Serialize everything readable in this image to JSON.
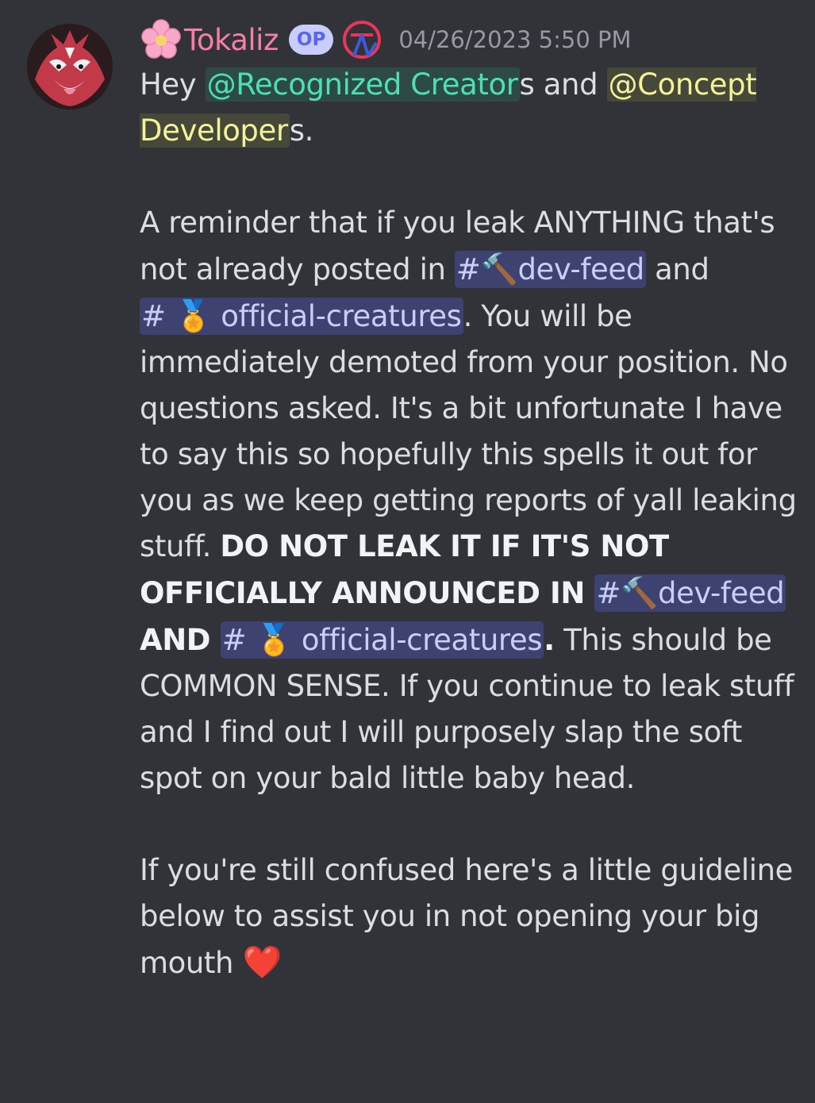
{
  "message": {
    "author": "Tokaliz",
    "author_color": "#f47fa6",
    "badge": "OP",
    "timestamp": "04/26/2023 5:50 PM",
    "icons": {
      "name_prefix": "cherry-blossom-icon",
      "role": "role-badge-icon"
    },
    "body": {
      "greeting_hey": "Hey ",
      "mention_creators": "@Recognized Creator",
      "s_and": "s and ",
      "mention_developers": "@Concept Developer",
      "s_period": "s.",
      "p2_part1": "A reminder that if you leak ANYTHING that's not already posted in ",
      "channel_devfeed": "dev-feed",
      "and": " and ",
      "channel_official": "official-creatures",
      "p2_part2": ". You will be immediately demoted from your position. No questions asked. It's a bit unfortunate I have to say this so hopefully this spells it out for you as we keep getting reports of yall leaking stuff. ",
      "bold1": "DO NOT LEAK IT IF IT'S NOT OFFICIALLY ANNOUNCED IN ",
      "bold_and": " AND ",
      "bold_period": ".",
      "p2_part3": " This should be COMMON SENSE. If you continue to leak stuff and I find out I will purposely slap the soft spot on your bald little baby head.",
      "p3": "If you're still confused here's a little guideline below to assist you in not opening your big mouth ",
      "heart": "❤️",
      "hash": "#",
      "hammer": "🔨",
      "medal": "🏅"
    }
  },
  "colors": {
    "background": "#313338",
    "text": "#dbdee1",
    "mention_creators": "#4ee0b5",
    "mention_developers": "#f3f39a",
    "channel_mention": "#c9cdfb",
    "timestamp": "#949ba4"
  }
}
